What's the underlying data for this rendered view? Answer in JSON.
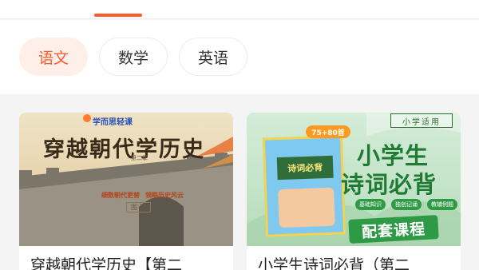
{
  "tabs": {
    "active_color": "#ff5a2e"
  },
  "subjects": [
    {
      "label": "语文",
      "active": true
    },
    {
      "label": "数学",
      "active": false
    },
    {
      "label": "英语",
      "active": false
    }
  ],
  "courses": [
    {
      "title": "穿越朝代学历史【第二",
      "cover": {
        "brand": "学而思轻课",
        "heading": "穿越朝代学历史",
        "episode": "第二季",
        "line1": "细数朝代更替",
        "line2": "领略历史风云",
        "button": "图 屋"
      }
    },
    {
      "title": "小学生诗词必背（第二",
      "cover": {
        "tag": "小学适用",
        "badge": "75+80首",
        "book_title": "诗词必背",
        "headline_1": "小学生",
        "headline_2": "诗词必背",
        "pills": [
          "基础知识",
          "独创记诵",
          "教辅例题"
        ],
        "banner": "配套课程"
      }
    }
  ]
}
